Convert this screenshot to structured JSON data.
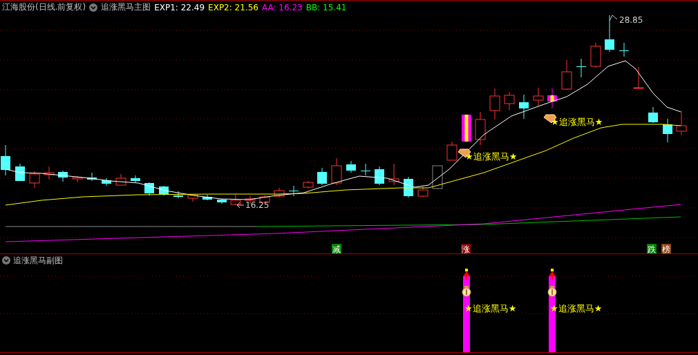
{
  "header": {
    "stock": "江海股份(日线.前复权)",
    "indicator": "追涨黑马主图",
    "values": [
      {
        "label": "EXP1: 22.49",
        "color": "#ffffff"
      },
      {
        "label": "EXP2: 21.56",
        "color": "#ffff00"
      },
      {
        "label": "AA: 16.23",
        "color": "#ff00ff"
      },
      {
        "label": "BB: 15.41",
        "color": "#00ff00"
      }
    ]
  },
  "main_chart": {
    "high_label": "28.85",
    "low_label": "16.25",
    "signals": [
      {
        "text": "★追涨黑马★"
      },
      {
        "text": "★追涨黑马★"
      }
    ],
    "tags": [
      {
        "text": "减",
        "color": "#008000"
      },
      {
        "text": "涨",
        "color": "#8b0000"
      },
      {
        "text": "跌",
        "color": "#008000"
      },
      {
        "text": "榜",
        "color": "#8b4513"
      }
    ]
  },
  "sub_chart": {
    "title": "追涨黑马副图",
    "signals": [
      {
        "text": "★追涨黑马★"
      },
      {
        "text": "★追涨黑马★"
      }
    ]
  }
}
